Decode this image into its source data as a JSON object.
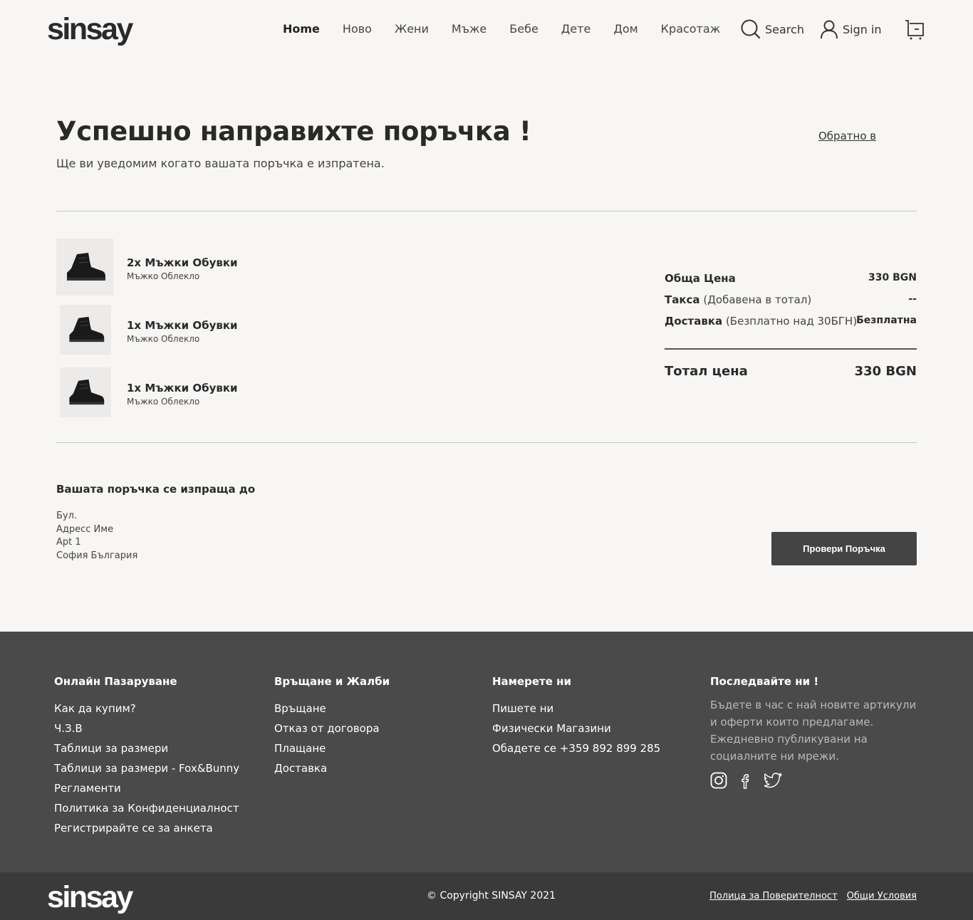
{
  "header": {
    "logo": "sinsay",
    "nav": [
      "Home",
      "Ново",
      "Жени",
      "Мъже",
      "Бебе",
      "Дете",
      "Дом",
      "Красотаж"
    ],
    "search_label": "Search",
    "signin_label": "Sign in"
  },
  "confirmation": {
    "title": "Успешно направихте поръчка !",
    "subtitle": "Ще ви уведомим когато вашата поръчка е изпратена.",
    "back_link": "Обратно в"
  },
  "items": [
    {
      "name": "2x Мъжки Обувки",
      "category": "Мъжко Облекло"
    },
    {
      "name": "1x Мъжки Обувки",
      "category": "Мъжко Облекло"
    },
    {
      "name": "1x Мъжки Обувки",
      "category": "Мъжко Облекло"
    }
  ],
  "summary": {
    "subtotal_label": "Обща Цена",
    "subtotal_value": "330 BGN",
    "tax_label": "Такса",
    "tax_note": "(Добавена в тотал)",
    "tax_value": "--",
    "delivery_label": "Доставка",
    "delivery_note": "(Безплатно над 30БГН)",
    "delivery_value": "Безплатна",
    "total_label": "Тотал цена",
    "total_value": "330 BGN"
  },
  "shipping": {
    "title": "Вашата поръчка се изпраща до",
    "lines": [
      "Бул.",
      "Адресс Име",
      "Apt 1",
      "София България"
    ],
    "check_button": "Провери Поръчка"
  },
  "footer": {
    "col1": {
      "title": "Онлайн Пазаруване",
      "links": [
        "Как да купим?",
        "Ч.З.В",
        "Таблици за размери",
        "Таблици за размери - Fox&Bunny",
        "Регламенти",
        "Политика за Конфиденциалност",
        "Регистрирайте се за анкета"
      ]
    },
    "col2": {
      "title": "Връщане и Жалби",
      "links": [
        "Връщане",
        "Отказ от договора",
        "Плащане",
        "Доставка"
      ]
    },
    "col3": {
      "title": "Намерете ни",
      "links": [
        "Пишете ни",
        "Физически Магазини",
        "Обадете се +359 892 899 285"
      ]
    },
    "col4": {
      "title": "Последвайте ни !",
      "description": "Бъдете в час с най новите артикули и оферти които предлагаме. Ежедневно публикувани на социалните ни мрежи.",
      "social": [
        "instagram-icon",
        "facebook-icon",
        "twitter-icon"
      ]
    },
    "copyright": "© Copyright SINSAY 2021",
    "legal": [
      "Полица за Поверителност",
      "Общи Условия"
    ]
  }
}
